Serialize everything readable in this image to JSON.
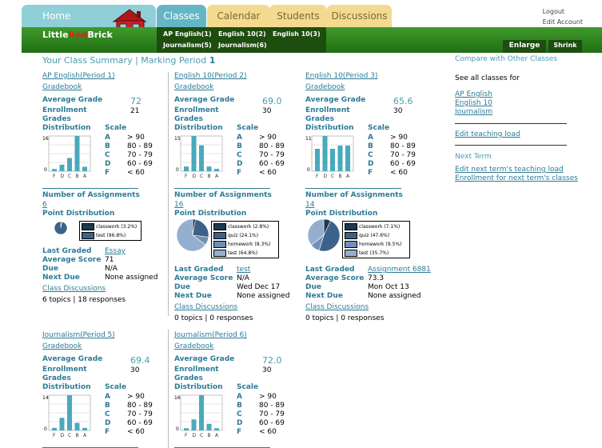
{
  "nav": {
    "home": "Home",
    "tabs": [
      "Classes",
      "Calendar",
      "Students",
      "Discussions"
    ],
    "logo_a": "Little",
    "logo_b": "Red",
    "logo_c": "Brick",
    "logout": "Logout",
    "edit_account": "Edit Account",
    "sub": [
      "AP English(1)",
      "English 10(2)",
      "English 10(3)",
      "Journalism(5)",
      "Journalism(6)"
    ],
    "enlarge": "Enlarge",
    "shrink": "Shrink"
  },
  "title": "Your Class Summary | Marking Period ",
  "period": "1",
  "labels": {
    "gradebook": "Gradebook",
    "avg": "Average Grade",
    "enroll": "Enrollment",
    "grades": "Grades",
    "dist": "Distribution",
    "scale": "Scale",
    "nassign": "Number of Assignments",
    "pdist": "Point Distribution",
    "lastgraded": "Last Graded",
    "avgscore": "Average Score",
    "due": "Due",
    "nextdue": "Next Due",
    "disc": "Class Discussions"
  },
  "scale": [
    [
      "A",
      "> 90"
    ],
    [
      "B",
      "80 - 89"
    ],
    [
      "C",
      "70 - 79"
    ],
    [
      "D",
      "60 - 69"
    ],
    [
      "F",
      "< 60"
    ]
  ],
  "classes": [
    {
      "name": "AP English(Period 1)",
      "avg": "72",
      "enroll": "21",
      "ymax": "16",
      "bars": [
        0.05,
        0.2,
        0.35,
        1.0,
        0.15
      ],
      "nassign": "6",
      "legend": [
        "classwork (3.2%)",
        "test (96.8%)"
      ],
      "pie": [
        3.2,
        96.8
      ],
      "last": "Essay",
      "score": "71",
      "due": "N/A",
      "next": "None assigned",
      "topics": "6 topics | 18 responses"
    },
    {
      "name": "English 10(Period 2)",
      "avg": "69.0",
      "enroll": "30",
      "ymax": "15",
      "bars": [
        0.12,
        1.0,
        0.7,
        0.12,
        0.05
      ],
      "nassign": "16",
      "legend": [
        "classwork (2.8%)",
        "quiz (24.1%)",
        "homework (8.3%)",
        "test (64.8%)"
      ],
      "pie": [
        2.8,
        24.1,
        8.3,
        64.8
      ],
      "last": "test",
      "score": "N/A",
      "due": "Wed Dec 17",
      "next": "None assigned",
      "topics": "0 topics | 0 responses"
    },
    {
      "name": "English 10(Period 3)",
      "avg": "65.6",
      "enroll": "30",
      "ymax": "11",
      "bars": [
        0.65,
        1.0,
        0.6,
        0.75,
        0.7
      ],
      "nassign": "14",
      "legend": [
        "classwork (7.1%)",
        "quiz (47.6%)",
        "homework (9.5%)",
        "test (35.7%)"
      ],
      "pie": [
        7.1,
        47.6,
        9.5,
        35.7
      ],
      "last": "Assignment 6881",
      "score": "73.3",
      "due": "Mon Oct 13",
      "next": "None assigned",
      "topics": "0 topics | 0 responses"
    },
    {
      "name": "Journalism(Period 5)",
      "avg": "69.4",
      "enroll": "30",
      "ymax": "14",
      "bars": [
        0.08,
        0.35,
        1.0,
        0.22,
        0.05
      ]
    },
    {
      "name": "Journalism(Period 6)",
      "avg": "72.0",
      "enroll": "30",
      "ymax": "16",
      "bars": [
        0.08,
        0.3,
        1.0,
        0.15,
        0.05
      ]
    }
  ],
  "right": {
    "compare": "Compare with Other Classes",
    "see_all": "See all classes for",
    "links": [
      "AP English",
      "English 10",
      "Journalism"
    ],
    "edit_load": "Edit teaching load",
    "next_term": "Next Term",
    "next_links": [
      "Edit next term's teaching load",
      "Enrollment for next term's classes"
    ]
  },
  "chart_data": [
    {
      "type": "bar",
      "title": "AP English(Period 1)",
      "categories": [
        "F",
        "D",
        "C",
        "B",
        "A"
      ],
      "values": [
        1,
        3,
        6,
        16,
        2
      ],
      "ylim": [
        0,
        16
      ]
    },
    {
      "type": "bar",
      "title": "English 10(Period 2)",
      "categories": [
        "F",
        "D",
        "C",
        "B",
        "A"
      ],
      "values": [
        2,
        15,
        11,
        2,
        1
      ],
      "ylim": [
        0,
        15
      ]
    },
    {
      "type": "bar",
      "title": "English 10(Period 3)",
      "categories": [
        "F",
        "D",
        "C",
        "B",
        "A"
      ],
      "values": [
        7,
        11,
        7,
        8,
        8
      ],
      "ylim": [
        0,
        11
      ]
    },
    {
      "type": "bar",
      "title": "Journalism(Period 5)",
      "categories": [
        "F",
        "D",
        "C",
        "B",
        "A"
      ],
      "values": [
        1,
        5,
        14,
        3,
        1
      ],
      "ylim": [
        0,
        14
      ]
    },
    {
      "type": "bar",
      "title": "Journalism(Period 6)",
      "categories": [
        "F",
        "D",
        "C",
        "B",
        "A"
      ],
      "values": [
        1,
        5,
        16,
        3,
        1
      ],
      "ylim": [
        0,
        16
      ]
    }
  ],
  "colors": {
    "accent": "#2c7b96",
    "bar": "#4aa9bd",
    "green": "#2f8a1f",
    "pie": [
      "#1f3850",
      "#3d6289",
      "#6f8fb6",
      "#95aed0"
    ]
  }
}
